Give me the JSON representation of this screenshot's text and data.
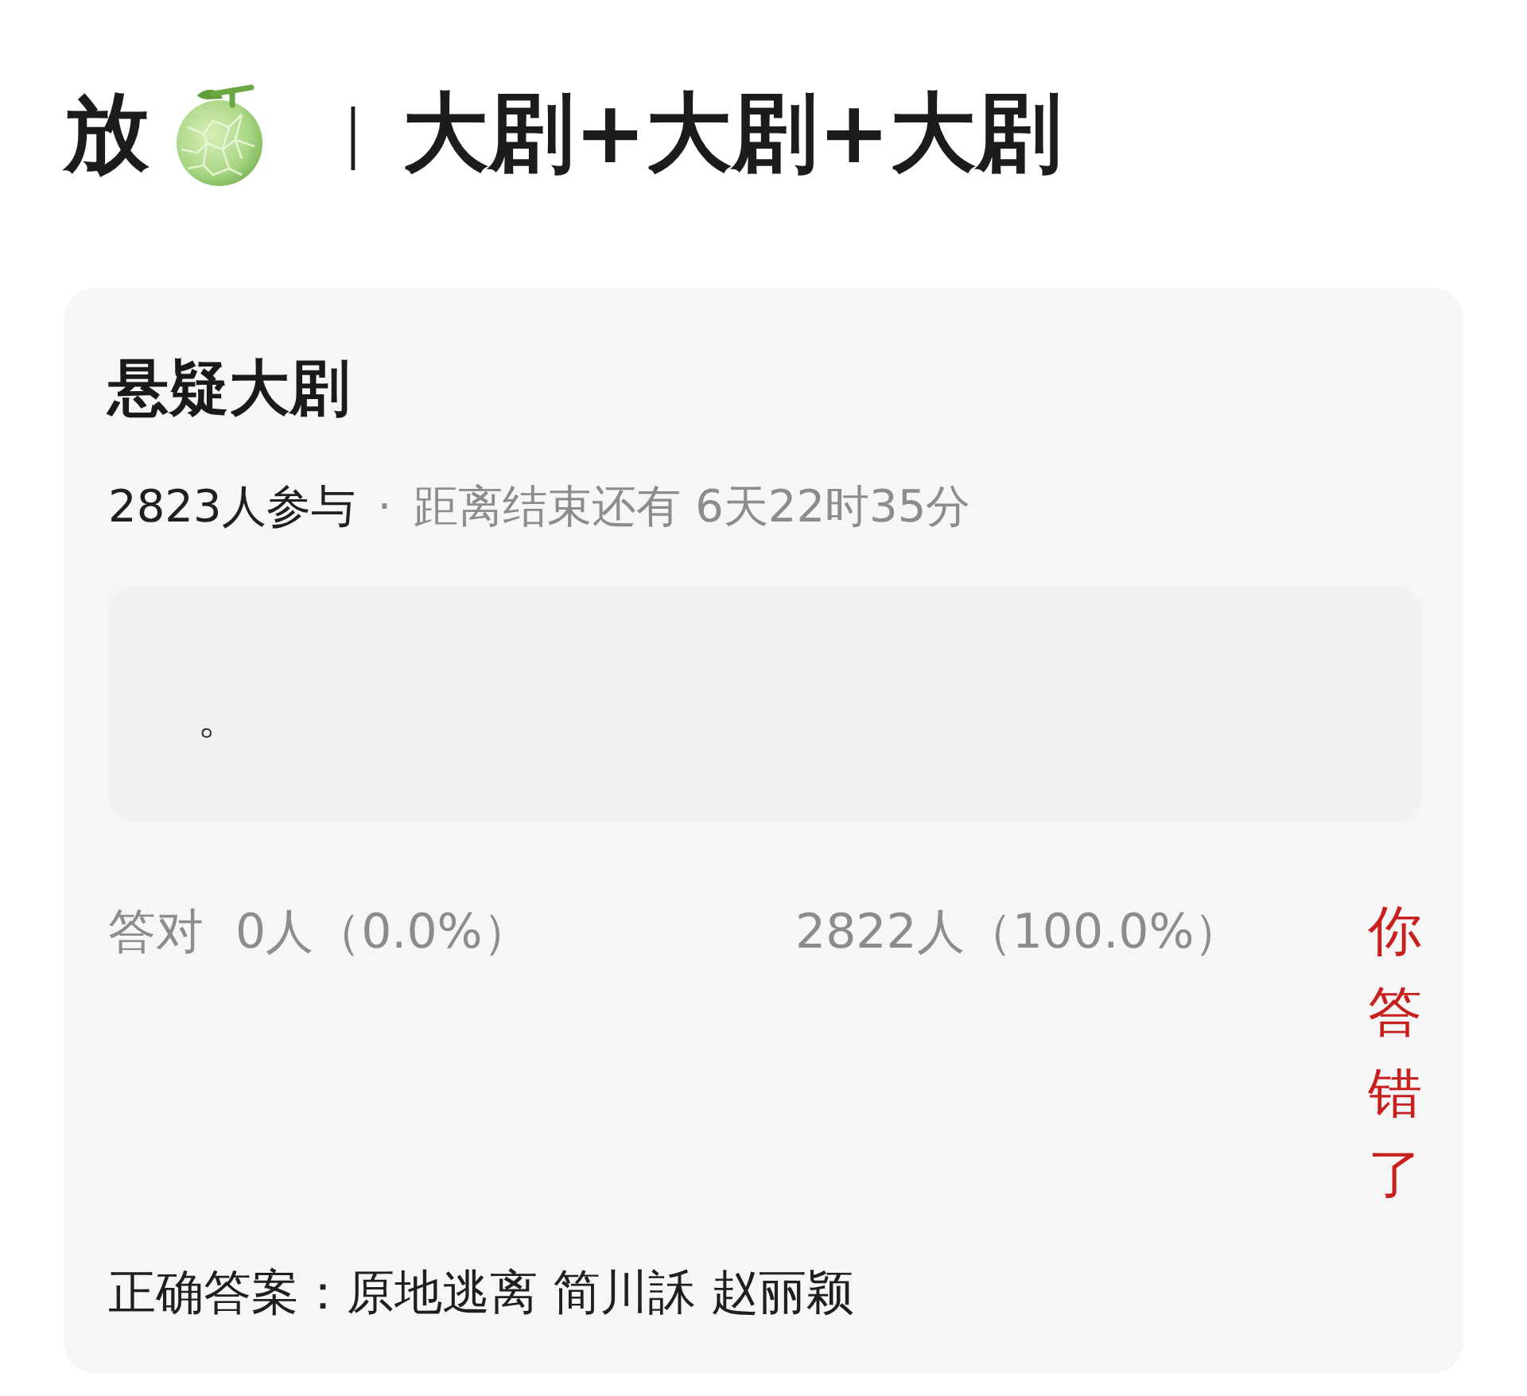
{
  "header": {
    "prefix": "放",
    "separator": "｜",
    "title": "大剧+大剧+大剧"
  },
  "card": {
    "title": "悬疑大剧",
    "participants": "2823人参与",
    "dot": "·",
    "countdown": "距离结束还有 6天22时35分",
    "question": {
      "text": "。"
    },
    "results": [
      {
        "label": "答对",
        "count": "0人（0.0%）"
      },
      {
        "count": "2822人（100.0%）"
      }
    ],
    "verdict": {
      "text": "你答错了",
      "correct": false
    },
    "answer": "正确答案：原地逃离 简川訸 赵丽颖"
  }
}
